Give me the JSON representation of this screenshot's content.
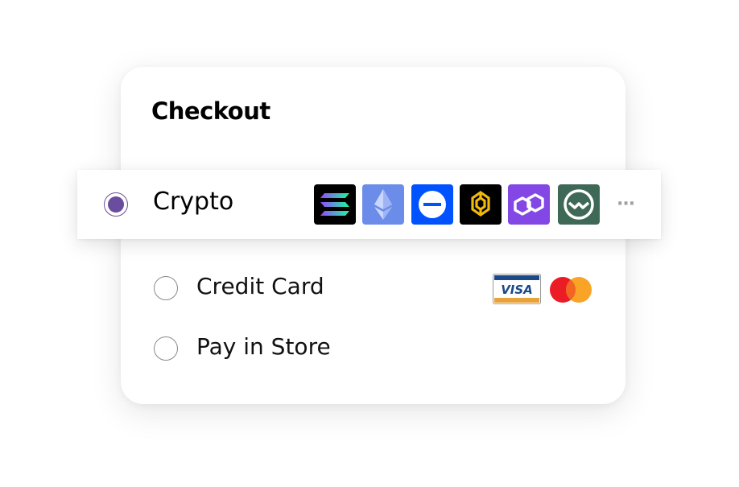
{
  "checkout": {
    "title": "Checkout"
  },
  "payment_options": {
    "crypto": {
      "label": "Crypto",
      "selected": true,
      "icons": [
        "solana-icon",
        "ethereum-icon",
        "coinbase-icon",
        "binance-icon",
        "polygon-icon",
        "gnosis-icon"
      ],
      "more_label": "···"
    },
    "credit_card": {
      "label": "Credit Card",
      "selected": false,
      "icons": [
        "visa-icon",
        "mastercard-icon"
      ],
      "visa_text": "VISA"
    },
    "pay_in_store": {
      "label": "Pay in Store",
      "selected": false
    }
  },
  "colors": {
    "selected_radio": "#6a4d9e",
    "ethereum_bg": "#6b8ce8",
    "coinbase_bg": "#0052ff",
    "binance_bg": "#000000",
    "binance_gold": "#f0b90b",
    "polygon_bg": "#8247e5",
    "gnosis_bg": "#3e6957"
  }
}
